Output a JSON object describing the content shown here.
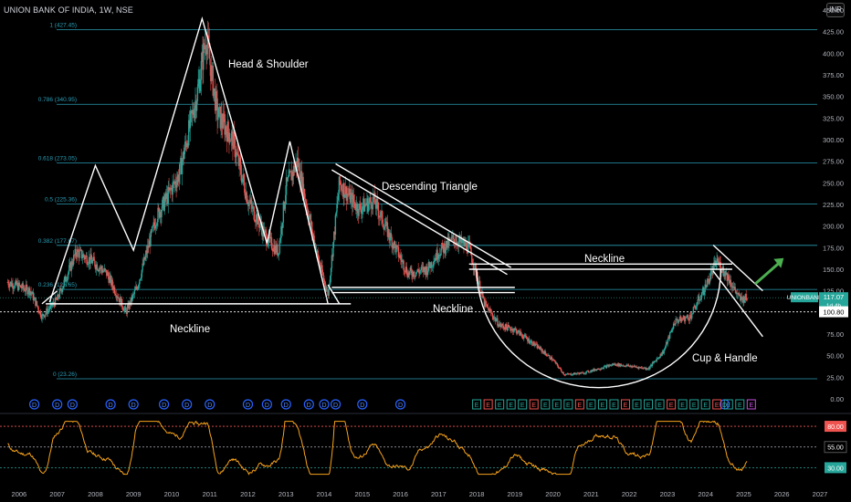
{
  "title": "UNION BANK OF INDIA, 1W, NSE",
  "currency": "INR",
  "colors": {
    "bg": "#000000",
    "fib": "#2a9db5",
    "up": "#26a69a",
    "down": "#ef5350",
    "rsi": "#f7a21b",
    "white": "#ffffff",
    "arrow": "#4caf50",
    "divEarnings": "#2962ff"
  },
  "chart_data": {
    "type": "candlestick",
    "x_labels": [
      "2006",
      "2007",
      "2008",
      "2009",
      "2010",
      "2011",
      "2012",
      "2013",
      "2014",
      "2015",
      "2016",
      "2017",
      "2018",
      "2019",
      "2020",
      "2021",
      "2022",
      "2023",
      "2024",
      "2025",
      "2026",
      "2027"
    ],
    "y_ticks": [
      0,
      25,
      50,
      75,
      100,
      125,
      150,
      175,
      200,
      225,
      250,
      275,
      300,
      325,
      350,
      375,
      400,
      425,
      450
    ],
    "y_tick_labels": [
      "0.00",
      "25.00",
      "50.00",
      "75.00",
      "100.00",
      "125.00",
      "150.00",
      "175.00",
      "200.00",
      "225.00",
      "250.00",
      "275.00",
      "300.00",
      "325.00",
      "350.00",
      "375.00",
      "400.00",
      "425.00",
      "450.00"
    ],
    "ylim": [
      0,
      450
    ],
    "price_path": [
      [
        2005.7,
        135
      ],
      [
        2006.3,
        125
      ],
      [
        2006.6,
        95
      ],
      [
        2007.0,
        115
      ],
      [
        2007.5,
        170
      ],
      [
        2007.9,
        160
      ],
      [
        2008.3,
        145
      ],
      [
        2008.8,
        100
      ],
      [
        2009.1,
        130
      ],
      [
        2009.6,
        210
      ],
      [
        2010.2,
        260
      ],
      [
        2010.7,
        360
      ],
      [
        2010.9,
        420
      ],
      [
        2011.2,
        330
      ],
      [
        2011.6,
        300
      ],
      [
        2012.0,
        230
      ],
      [
        2012.5,
        185
      ],
      [
        2012.8,
        170
      ],
      [
        2013.0,
        245
      ],
      [
        2013.3,
        275
      ],
      [
        2013.8,
        170
      ],
      [
        2014.1,
        120
      ],
      [
        2014.4,
        250
      ],
      [
        2014.9,
        220
      ],
      [
        2015.3,
        230
      ],
      [
        2015.7,
        190
      ],
      [
        2016.2,
        145
      ],
      [
        2016.7,
        150
      ],
      [
        2017.0,
        170
      ],
      [
        2017.4,
        185
      ],
      [
        2017.8,
        175
      ],
      [
        2018.2,
        110
      ],
      [
        2018.6,
        85
      ],
      [
        2019.0,
        80
      ],
      [
        2019.6,
        60
      ],
      [
        2020.0,
        45
      ],
      [
        2020.3,
        28
      ],
      [
        2020.8,
        30
      ],
      [
        2021.2,
        35
      ],
      [
        2021.6,
        40
      ],
      [
        2022.0,
        38
      ],
      [
        2022.5,
        35
      ],
      [
        2022.9,
        55
      ],
      [
        2023.2,
        90
      ],
      [
        2023.6,
        95
      ],
      [
        2024.0,
        130
      ],
      [
        2024.3,
        160
      ],
      [
        2024.6,
        140
      ],
      [
        2024.9,
        115
      ],
      [
        2025.1,
        117
      ]
    ],
    "fib_levels": [
      {
        "label": "1 (427.45)",
        "value": 427.45
      },
      {
        "label": "0.786 (340.95)",
        "value": 340.95
      },
      {
        "label": "0.618 (273.05)",
        "value": 273.05
      },
      {
        "label": "0.5 (225.36)",
        "value": 225.36
      },
      {
        "label": "0.382 (177.67)",
        "value": 177.67
      },
      {
        "label": "0.236 (126.65)",
        "value": 126.65
      },
      {
        "label": "0 (23.26)",
        "value": 23.26
      }
    ],
    "last_price": {
      "symbol": "UNIONBANK",
      "price": "117.07",
      "timer": "1d 4h"
    },
    "horizontal_level": {
      "label": "100.80",
      "value": 100.8
    },
    "patterns": {
      "head_shoulder": "Head & Shoulder",
      "neckline_1": "Neckline",
      "descending_triangle": "Descending Triangle",
      "neckline_2": "Neckline",
      "neckline_3": "Neckline",
      "cup_handle": "Cup & Handle"
    },
    "rsi": {
      "levels": [
        {
          "label": "80.00",
          "value": 80
        },
        {
          "label": "55.00",
          "value": 55
        },
        {
          "label": "30.00",
          "value": 30
        }
      ],
      "range": [
        15,
        90
      ]
    },
    "event_markers": {
      "dividend_label": "D",
      "earnings_label": "E",
      "dividend_years": [
        2006.4,
        2007.0,
        2007.4,
        2008.4,
        2009.0,
        2009.8,
        2010.4,
        2011.0,
        2012.0,
        2012.5,
        2013.0,
        2013.6,
        2014.0,
        2014.3,
        2015.0,
        2016.0,
        2024.5
      ],
      "earnings_years": [
        2018.0,
        2018.3,
        2018.6,
        2018.9,
        2019.2,
        2019.5,
        2019.8,
        2020.1,
        2020.4,
        2020.7,
        2021.0,
        2021.3,
        2021.6,
        2021.9,
        2022.2,
        2022.5,
        2022.8,
        2023.1,
        2023.4,
        2023.7,
        2024.0,
        2024.3,
        2024.6,
        2024.9,
        2025.2
      ]
    }
  }
}
